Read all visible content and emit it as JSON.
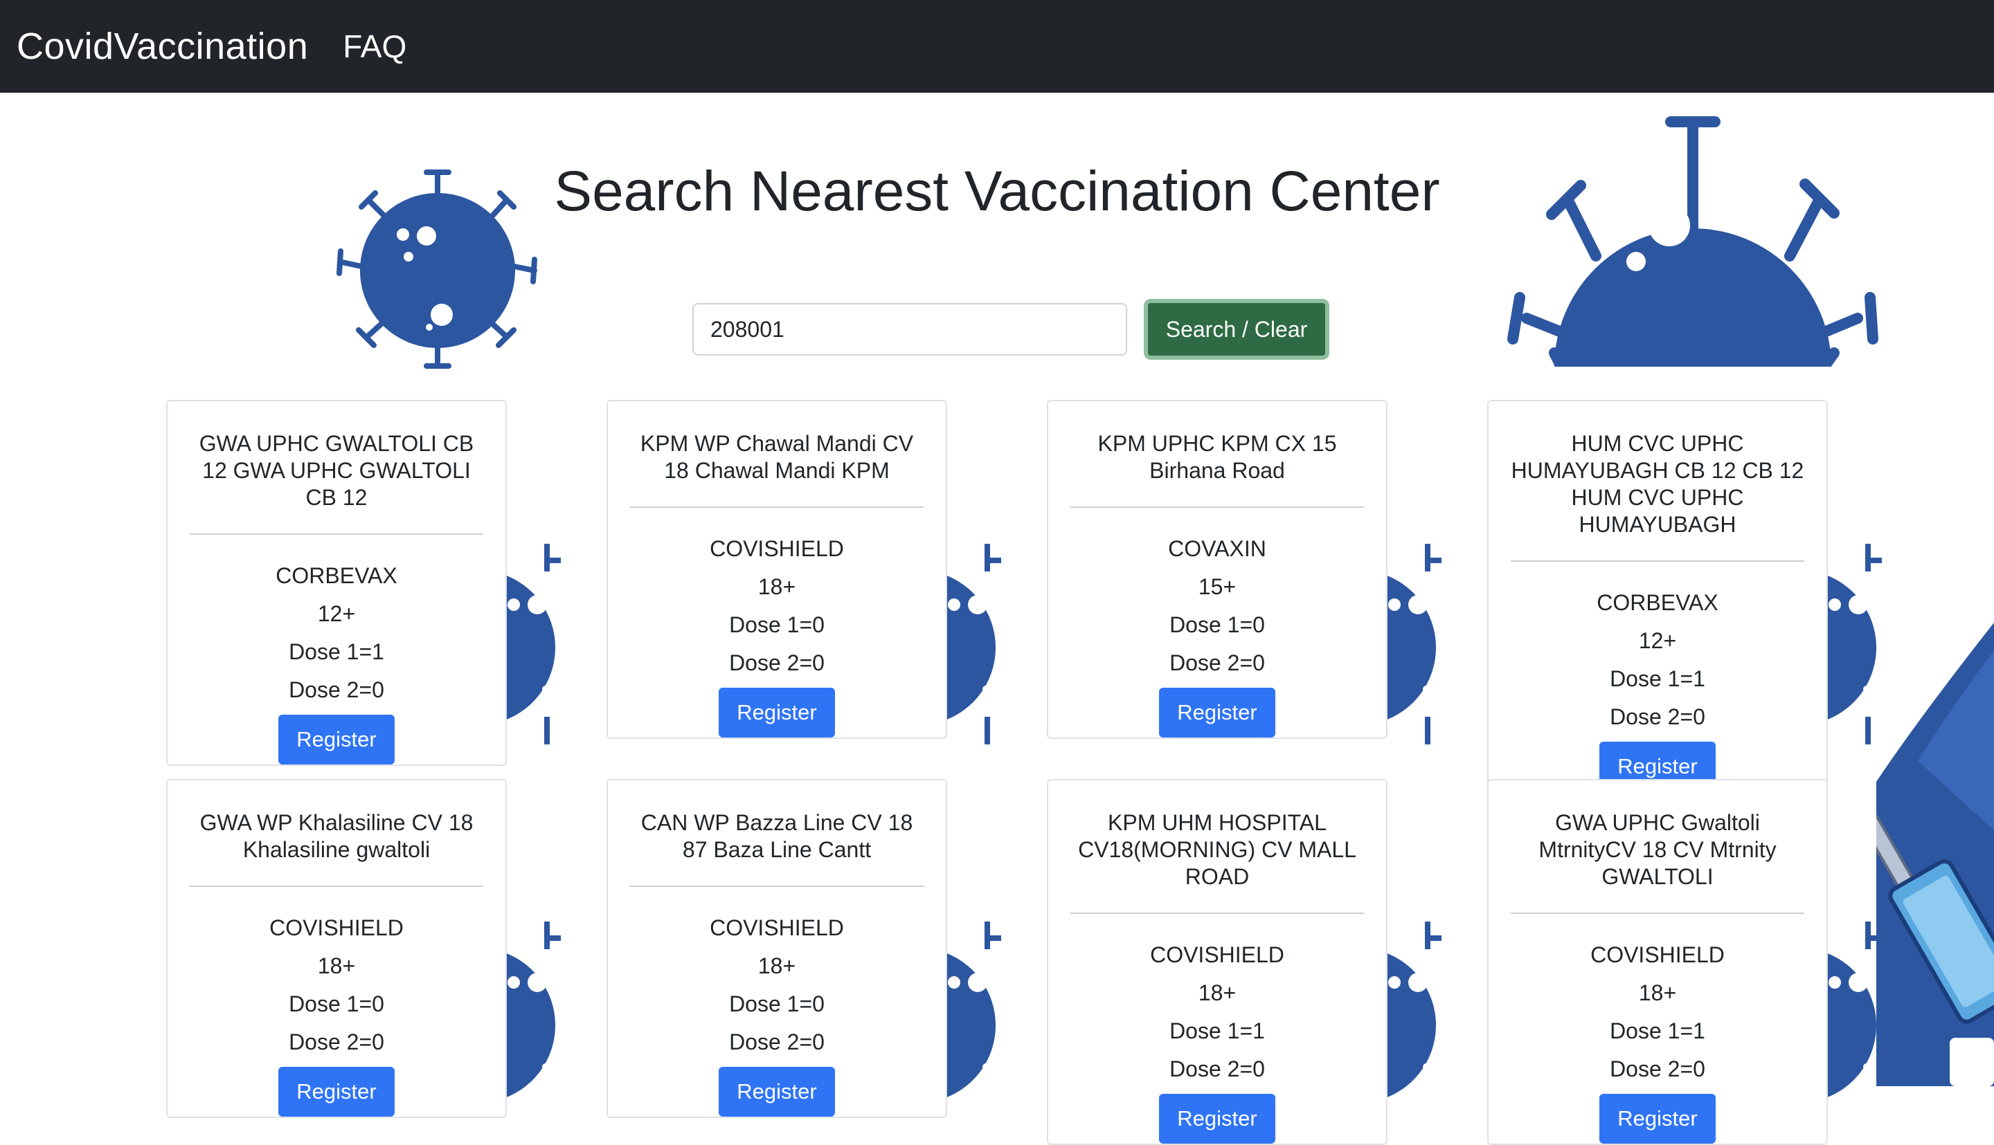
{
  "navbar": {
    "brand": "CovidVaccination",
    "links": [
      "FAQ"
    ]
  },
  "page": {
    "title": "Search Nearest Vaccination Center"
  },
  "search": {
    "value": "208001",
    "button_label": "Search / Clear"
  },
  "colors": {
    "navbar_bg": "#212529",
    "virus_blue": "#2c56a0",
    "search_button": "#2e6b44",
    "register_button": "#2f74f5"
  },
  "icons": [
    "virus-icon",
    "syringe-icon"
  ],
  "centers": [
    {
      "name": "GWA UPHC GWALTOLI CB 12 GWA UPHC GWALTOLI CB 12",
      "vaccine": "CORBEVAX",
      "age": "12+",
      "dose1": "Dose 1=1",
      "dose2": "Dose 2=0",
      "register_label": "Register"
    },
    {
      "name": "KPM WP Chawal Mandi CV 18 Chawal Mandi KPM",
      "vaccine": "COVISHIELD",
      "age": "18+",
      "dose1": "Dose 1=0",
      "dose2": "Dose 2=0",
      "register_label": "Register"
    },
    {
      "name": "KPM UPHC KPM CX 15 Birhana Road",
      "vaccine": "COVAXIN",
      "age": "15+",
      "dose1": "Dose 1=0",
      "dose2": "Dose 2=0",
      "register_label": "Register"
    },
    {
      "name": "HUM CVC UPHC HUMAYUBAGH CB 12 CB 12 HUM CVC UPHC HUMAYUBAGH",
      "vaccine": "CORBEVAX",
      "age": "12+",
      "dose1": "Dose 1=1",
      "dose2": "Dose 2=0",
      "register_label": "Register"
    },
    {
      "name": "GWA WP Khalasiline CV 18 Khalasiline gwaltoli",
      "vaccine": "COVISHIELD",
      "age": "18+",
      "dose1": "Dose 1=0",
      "dose2": "Dose 2=0",
      "register_label": "Register"
    },
    {
      "name": "CAN WP Bazza Line CV 18 87 Baza Line Cantt",
      "vaccine": "COVISHIELD",
      "age": "18+",
      "dose1": "Dose 1=0",
      "dose2": "Dose 2=0",
      "register_label": "Register"
    },
    {
      "name": "KPM UHM HOSPITAL CV18(MORNING) CV MALL ROAD",
      "vaccine": "COVISHIELD",
      "age": "18+",
      "dose1": "Dose 1=1",
      "dose2": "Dose 2=0",
      "register_label": "Register"
    },
    {
      "name": "GWA UPHC Gwaltoli MtrnityCV 18 CV Mtrnity GWALTOLI",
      "vaccine": "COVISHIELD",
      "age": "18+",
      "dose1": "Dose 1=1",
      "dose2": "Dose 2=0",
      "register_label": "Register"
    }
  ]
}
